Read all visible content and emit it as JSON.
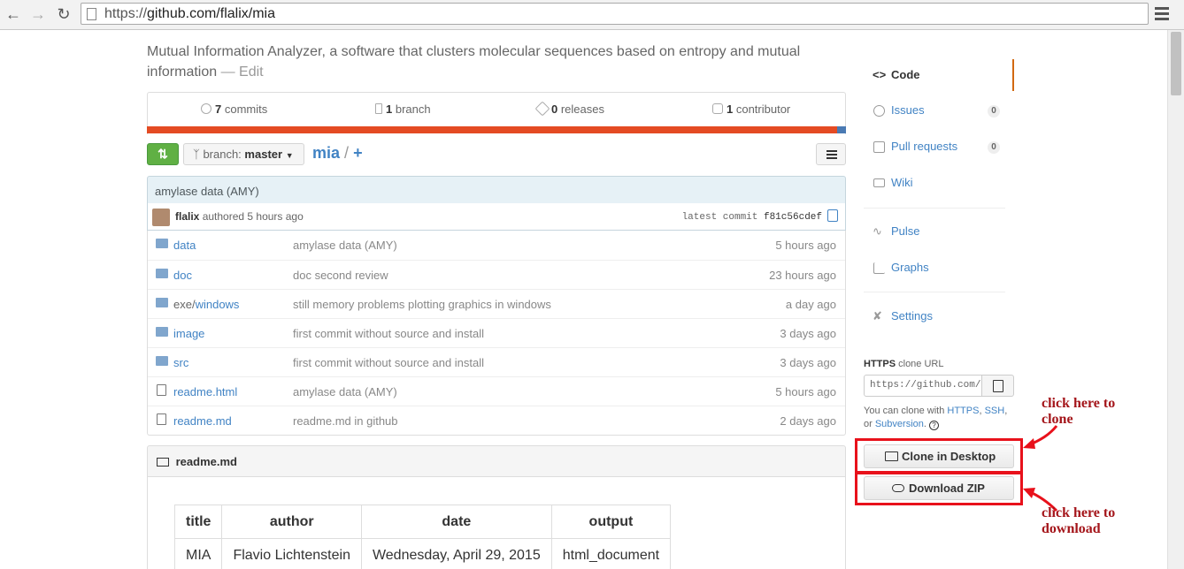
{
  "browser": {
    "url_prefix": "https://",
    "url_main": "github.com/flalix/mia"
  },
  "repo": {
    "description": "Mutual Information Analyzer, a software that clusters molecular sequences based on entropy and mutual information",
    "edit_label": "— Edit"
  },
  "summary": {
    "commits_count": "7",
    "commits_label": " commits",
    "branches_count": "1",
    "branches_label": " branch",
    "releases_count": "0",
    "releases_label": " releases",
    "contributors_count": "1",
    "contributors_label": " contributor"
  },
  "language_colors": {
    "main": "#e44b23",
    "secondary": "#4a7ab3"
  },
  "file_nav": {
    "branch_label": "branch: ",
    "branch_name": "master",
    "repo_name": "mia",
    "separator": "/",
    "plus": "+"
  },
  "commit": {
    "message": "amylase data (AMY)",
    "author": "flalix",
    "authored": " authored 5 hours ago",
    "latest_label": "latest commit ",
    "sha": "f81c56cdef"
  },
  "files": [
    {
      "type": "dir",
      "parent": "",
      "name": "data",
      "message": "amylase data (AMY)",
      "age": "5 hours ago"
    },
    {
      "type": "dir",
      "parent": "",
      "name": "doc",
      "message": "doc second review",
      "age": "23 hours ago"
    },
    {
      "type": "dir",
      "parent": "exe/",
      "name": "windows",
      "message": "still memory problems plotting graphics in windows",
      "age": "a day ago"
    },
    {
      "type": "dir",
      "parent": "",
      "name": "image",
      "message": "first commit without source and install",
      "age": "3 days ago"
    },
    {
      "type": "dir",
      "parent": "",
      "name": "src",
      "message": "first commit without source and install",
      "age": "3 days ago"
    },
    {
      "type": "file",
      "parent": "",
      "name": "readme.html",
      "message": "amylase data (AMY)",
      "age": "5 hours ago"
    },
    {
      "type": "file",
      "parent": "",
      "name": "readme.md",
      "message": "readme.md in github",
      "age": "2 days ago"
    }
  ],
  "readme": {
    "title": "readme.md",
    "table_headers": [
      "title",
      "author",
      "date",
      "output"
    ],
    "table_row": [
      "MIA",
      "Flavio Lichtenstein",
      "Wednesday, April 29, 2015",
      "html_document"
    ]
  },
  "sidebar": {
    "code": "Code",
    "issues": "Issues",
    "issues_count": "0",
    "pulls": "Pull requests",
    "pulls_count": "0",
    "wiki": "Wiki",
    "pulse": "Pulse",
    "graphs": "Graphs",
    "settings": "Settings",
    "clone_protocol": "HTTPS",
    "clone_label": " clone URL",
    "clone_url": "https://github.com/flalix/mia.git",
    "clone_help_prefix": "You can clone with ",
    "clone_help_https": "HTTPS",
    "clone_help_comma": ", ",
    "clone_help_ssh": "SSH",
    "clone_help_or": ", or ",
    "clone_help_svn": "Subversion",
    "clone_help_end": ". ",
    "help_glyph": "?",
    "clone_desktop": "Clone in Desktop",
    "download_zip": "Download ZIP"
  },
  "annotations": {
    "clone_note_line1": "click here to",
    "clone_note_line2": "clone",
    "download_note_line1": "click here to",
    "download_note_line2": "download",
    "highlight_color": "#e8111b"
  }
}
